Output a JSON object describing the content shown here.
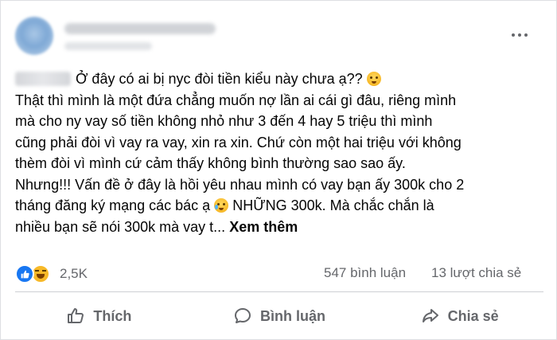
{
  "post": {
    "lines": [
      "Ở đây có ai bị nyc đòi tiền kiểu này chưa ạ??",
      "Thật thì mình là một đứa chẳng muốn nợ lần ai cái gì đâu, riêng mình",
      "mà cho ny vay số tiền không nhỏ như 3 đến 4 hay 5 triệu thì mình",
      "cũng phải đòi vì vay ra vay, xin ra xin. Chứ còn một hai triệu với không",
      "thèm đòi vì mình cứ cảm thấy không bình thường sao sao ấy.",
      "Nhưng!!! Vấn đề ở đây là hồi yêu nhau mình có vay bạn ấy 300k cho 2",
      "tháng đăng ký mạng các bác ạ",
      "NHỮNG 300k. Mà chắc chắn là",
      "nhiều bạn sẽ nói 300k mà vay t..."
    ],
    "see_more": "Xem thêm"
  },
  "stats": {
    "reaction_count": "2,5K",
    "comments": "547 bình luận",
    "shares": "13 lượt chia sẻ"
  },
  "actions": {
    "like": "Thích",
    "comment": "Bình luận",
    "share": "Chia sẻ"
  },
  "icons": {
    "more": "more-dots-icon",
    "like": "thumbs-up-icon",
    "comment": "speech-bubble-icon",
    "share": "share-arrow-icon",
    "reaction_like": "like-reaction-icon",
    "reaction_haha": "haha-reaction-icon"
  },
  "colors": {
    "like_blue": "#1877f2",
    "secondary_text": "#65676b",
    "emoji_yellow": "#f7b928"
  }
}
